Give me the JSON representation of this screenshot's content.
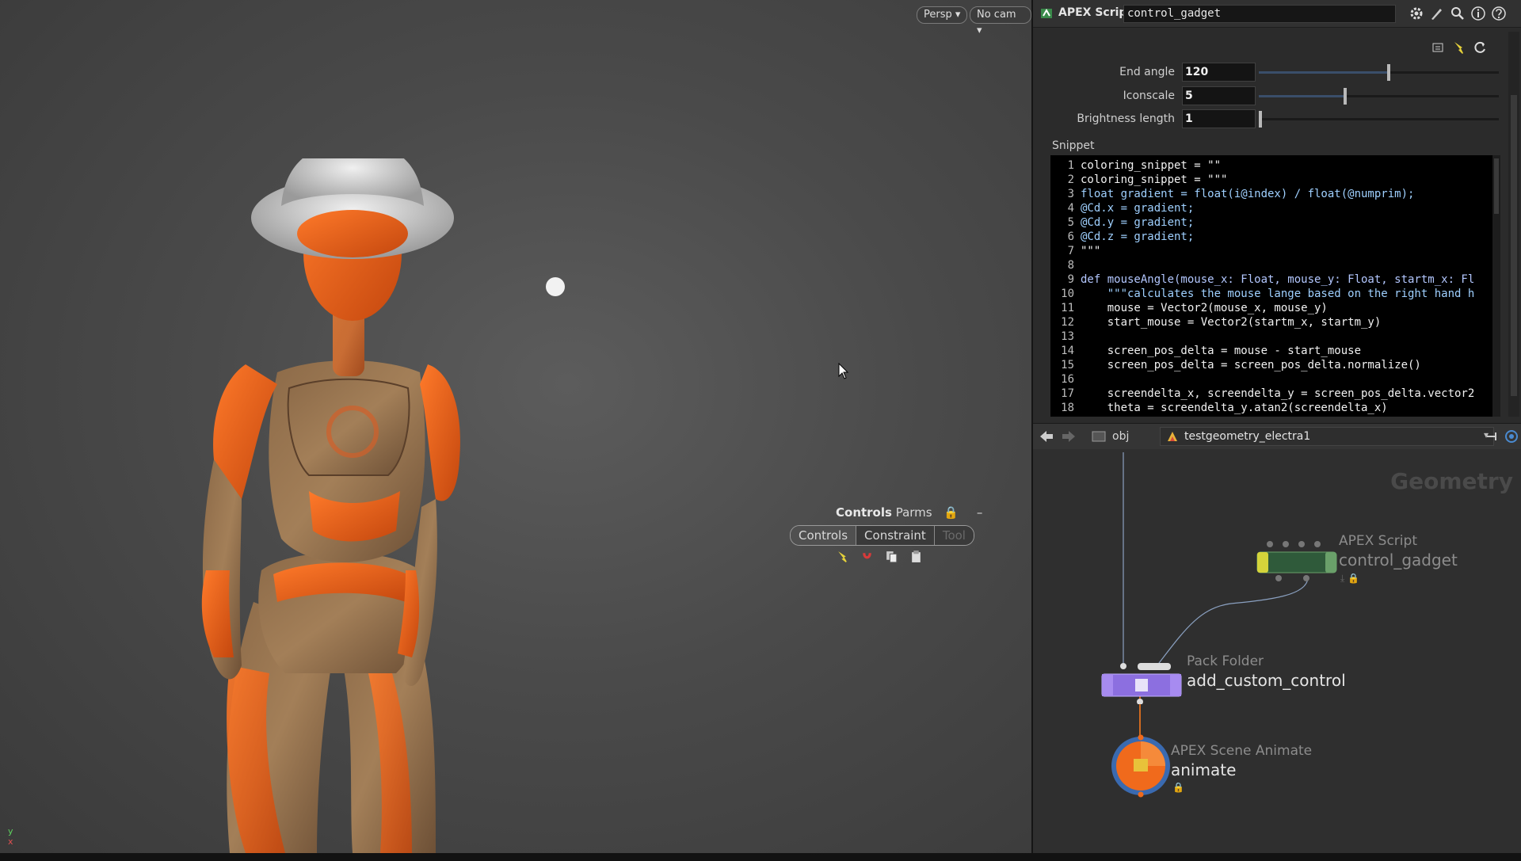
{
  "viewport": {
    "view_menu": "Persp",
    "camera_menu": "No cam",
    "axis_y": "y",
    "axis_x": "x"
  },
  "controls_panel": {
    "title_bold": "Controls",
    "title_rest": "Parms",
    "tabs": [
      "Controls",
      "Constraint",
      "Tool"
    ],
    "active_tab": "Controls",
    "tools": [
      "pick-tool-icon",
      "magnet-icon",
      "copy-icon",
      "paste-icon"
    ]
  },
  "apex_header": {
    "node_type": "APEX Script",
    "node_name": "control_gadget"
  },
  "parms": [
    {
      "label": "End angle",
      "value": "120",
      "slider_fraction": 0.54
    },
    {
      "label": "Iconscale",
      "value": "5",
      "slider_fraction": 0.36
    },
    {
      "label": "Brightness length",
      "value": "1",
      "slider_fraction": 0.0
    }
  ],
  "snippet": {
    "label": "Snippet",
    "lines": [
      {
        "n": "1",
        "text": "coloring_snippet = \"\"",
        "style": "plain"
      },
      {
        "n": "2",
        "text": "coloring_snippet = \"\"\"",
        "style": "plain"
      },
      {
        "n": "3",
        "text": "float gradient = float(i@index) / float(@numprim);",
        "style": "str"
      },
      {
        "n": "4",
        "text": "@Cd.x = gradient;",
        "style": "str"
      },
      {
        "n": "5",
        "text": "@Cd.y = gradient;",
        "style": "str"
      },
      {
        "n": "6",
        "text": "@Cd.z = gradient;",
        "style": "str"
      },
      {
        "n": "7",
        "text": "\"\"\"",
        "style": "plain"
      },
      {
        "n": "8",
        "text": "",
        "style": "plain"
      },
      {
        "n": "9",
        "text": "def mouseAngle(mouse_x: Float, mouse_y: Float, startm_x: Fl",
        "style": "def"
      },
      {
        "n": "10",
        "text": "    \"\"\"calculates the mouse lange based on the right hand h",
        "style": "str"
      },
      {
        "n": "11",
        "text": "    mouse = Vector2(mouse_x, mouse_y)",
        "style": "plain"
      },
      {
        "n": "12",
        "text": "    start_mouse = Vector2(startm_x, startm_y)",
        "style": "plain"
      },
      {
        "n": "13",
        "text": "",
        "style": "plain"
      },
      {
        "n": "14",
        "text": "    screen_pos_delta = mouse - start_mouse",
        "style": "plain"
      },
      {
        "n": "15",
        "text": "    screen_pos_delta = screen_pos_delta.normalize()",
        "style": "plain"
      },
      {
        "n": "16",
        "text": "",
        "style": "plain"
      },
      {
        "n": "17",
        "text": "    screendelta_x, screendelta_y = screen_pos_delta.vector2",
        "style": "plain"
      },
      {
        "n": "18",
        "text": "    theta = screendelta_y.atan2(screendelta_x)",
        "style": "plain"
      }
    ]
  },
  "network_bar": {
    "context": "obj",
    "path": "testgeometry_electra1"
  },
  "network": {
    "context_label": "Geometry",
    "nodes": [
      {
        "type": "APEX Script",
        "name": "control_gadget",
        "color": "#d4d43a"
      },
      {
        "type": "Pack Folder",
        "name": "add_custom_control",
        "color": "#9b80e8"
      },
      {
        "type": "APEX Scene Animate",
        "name": "animate",
        "color": "#f06a1c"
      }
    ]
  },
  "colors": {
    "accent_orange": "#f06a1c",
    "viewport_bg": "#4c4c4c",
    "panel_bg": "#2b2b2b"
  }
}
